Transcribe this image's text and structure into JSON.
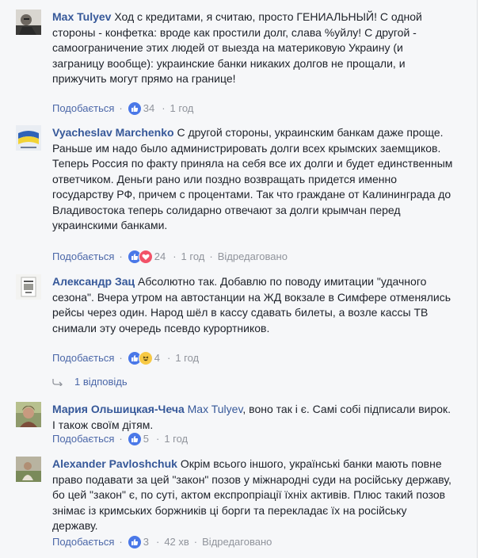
{
  "comments": [
    {
      "author": "Max Tulyev",
      "text": " Ход с кредитами, я считаю, просто ГЕНИАЛЬНЫЙ! С одной стороны - конфетка: вроде как простили долг, слава %уйлу! С другой - самоограничение этих людей от выезда на материковую Украину (и заграницу вообще): украинские банки никаких долгов не прощали, и прижучить могут прямо на границе!",
      "like_label": "Подобається",
      "reactions": [
        "like"
      ],
      "count": "34",
      "time": "1 год",
      "edited": ""
    },
    {
      "author": "Vyacheslav Marchenko",
      "text": " С другой стороны, украинским банкам даже проще. Раньше им надо было администрировать долги всех крымских заемщиков. Теперь Россия по факту приняла на себя все их долги и будет единственным ответчиком. Деньги рано или поздно возвращать придется именно государству РФ, причем с процентами. Так что граждане от Калининграда до Владивостока теперь солидарно отвечают за долги крымчан перед украинскими банками.",
      "like_label": "Подобається",
      "reactions": [
        "like",
        "love"
      ],
      "count": "24",
      "time": "1 год",
      "edited": "Відредаговано"
    },
    {
      "author": "Александр Зац",
      "text": " Абсолютно так. Добавлю по поводу имитации \"удачного сезона\". Вчера утром на автостанции на ЖД вокзале в Симфере отменялись рейсы через один. Народ шёл в кассу сдавать билеты, а возле кассы ТВ снимали эту очередь псевдо курортников.",
      "like_label": "Подобається",
      "reactions": [
        "like",
        "haha"
      ],
      "count": "4",
      "time": "1 год",
      "edited": "",
      "replies_label": "1 відповідь"
    },
    {
      "author": "Мария Ольшицкая-Чеча",
      "mention": "Max Tulyev",
      "text": ", воно так і є. Самі собі підписали вирок. І також своїм дітям.",
      "like_label": "Подобається",
      "reactions": [
        "like"
      ],
      "count": "5",
      "time": "1 год",
      "edited": ""
    },
    {
      "author": "Alexander Pavloshchuk",
      "text": " Окрім всього іншого, українські банки мають повне право подавати за цей \"закон\" позов у міжнародні суди на російську державу, бо цей \"закон\" є, по суті, актом експропріації їхніх активів. Плюс такий позов знімає із кримських боржників ці борги та перекладає їх на російську державу.",
      "like_label": "Подобається",
      "reactions": [
        "like"
      ],
      "count": "3",
      "time": "42 хв",
      "edited": "Відредаговано"
    }
  ],
  "colors": {
    "author": "#365899",
    "link": "#4b67a8",
    "meta": "#90949c",
    "like": "#4a78e8",
    "love": "#f25268",
    "haha": "#f7c945"
  }
}
